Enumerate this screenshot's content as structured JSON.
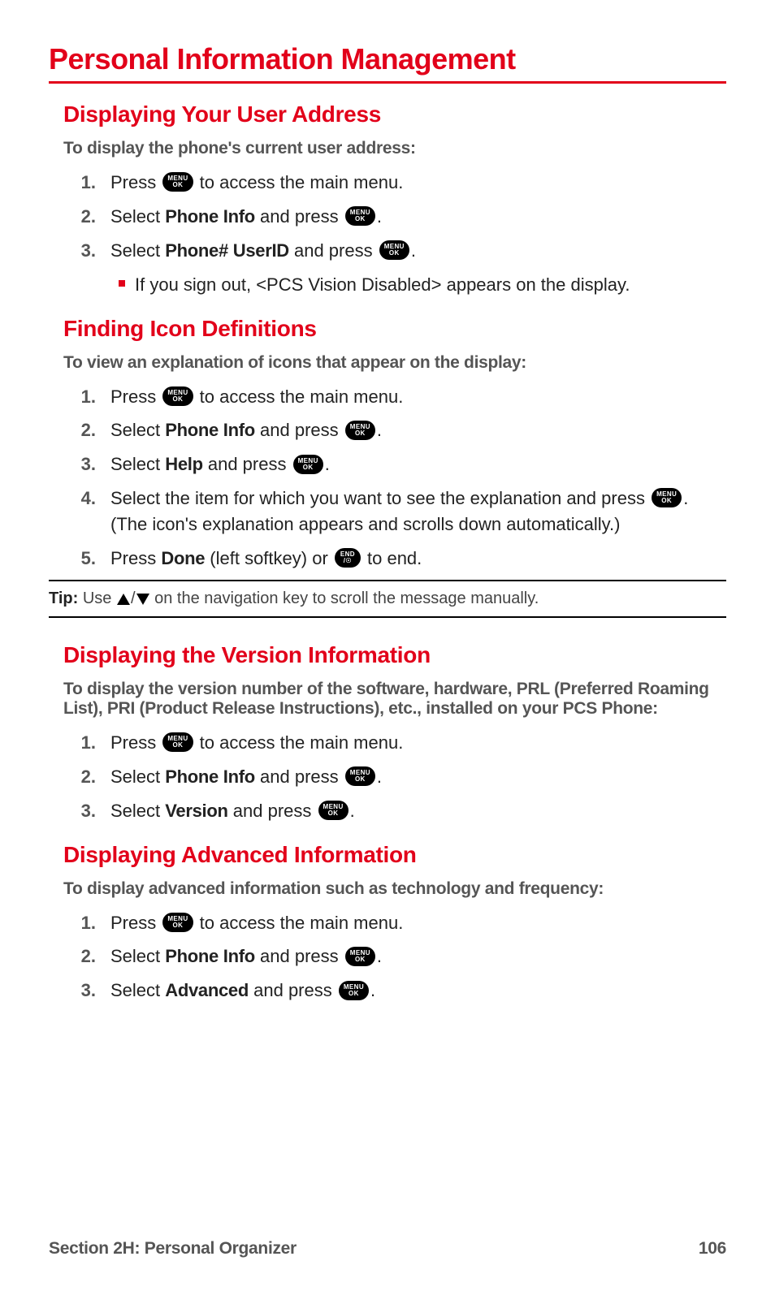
{
  "page_title": "Personal Information Management",
  "sections": [
    {
      "title": "Displaying Your User Address",
      "intro": "To display the phone's current user address:",
      "steps": [
        {
          "num": "1.",
          "pre": "Press ",
          "icon": "menu-ok",
          "post": " to access the main menu."
        },
        {
          "num": "2.",
          "pre": "Select ",
          "bold": "Phone Info",
          "mid": " and press ",
          "icon": "menu-ok",
          "post": "."
        },
        {
          "num": "3.",
          "pre": "Select ",
          "bold": "Phone# UserID",
          "mid": " and press ",
          "icon": "menu-ok",
          "post": "."
        }
      ],
      "sub": "If you sign out, <PCS Vision Disabled> appears on the display."
    },
    {
      "title": "Finding Icon Definitions",
      "intro": "To view an explanation of icons that appear on the display:",
      "steps": [
        {
          "num": "1.",
          "pre": "Press ",
          "icon": "menu-ok",
          "post": " to access the main menu."
        },
        {
          "num": "2.",
          "pre": "Select ",
          "bold": "Phone Info",
          "mid": " and press ",
          "icon": "menu-ok",
          "post": "."
        },
        {
          "num": "3.",
          "pre": "Select ",
          "bold": "Help",
          "mid": " and press ",
          "icon": "menu-ok",
          "post": "."
        },
        {
          "num": "4.",
          "pre": "Select the item for which you want to see the explanation and press ",
          "icon": "menu-ok",
          "post": ". (The icon's explanation appears and scrolls down automatically.)"
        },
        {
          "num": "5.",
          "pre": "Press ",
          "bold": "Done",
          "mid": " (left softkey) or ",
          "icon": "end",
          "post": " to end."
        }
      ]
    },
    {
      "title": "Displaying the Version Information",
      "intro": "To display the version number of the software, hardware, PRL (Preferred Roaming List), PRI (Product Release Instructions), etc., installed on your PCS Phone:",
      "steps": [
        {
          "num": "1.",
          "pre": "Press ",
          "icon": "menu-ok",
          "post": " to access the main menu."
        },
        {
          "num": "2.",
          "pre": "Select ",
          "bold": "Phone Info",
          "mid": " and press ",
          "icon": "menu-ok",
          "post": "."
        },
        {
          "num": "3.",
          "pre": "Select ",
          "bold": "Version",
          "mid": " and press ",
          "icon": "menu-ok",
          "post": "."
        }
      ]
    },
    {
      "title": "Displaying Advanced Information",
      "intro": "To display advanced information such as technology and frequency:",
      "steps": [
        {
          "num": "1.",
          "pre": "Press ",
          "icon": "menu-ok",
          "post": " to access the main menu."
        },
        {
          "num": "2.",
          "pre": "Select ",
          "bold": "Phone Info",
          "mid": " and press ",
          "icon": "menu-ok",
          "post": "."
        },
        {
          "num": "3.",
          "pre": "Select ",
          "bold": "Advanced",
          "mid": " and press ",
          "icon": "menu-ok",
          "post": "."
        }
      ]
    }
  ],
  "tip": {
    "label": "Tip:",
    "pre": " Use ",
    "post": " on the navigation key to scroll the message manually."
  },
  "icons": {
    "menu-ok": {
      "top": "MENU",
      "bottom": "OK"
    },
    "end": {
      "top": "END",
      "bottom": "/☉"
    }
  },
  "footer": {
    "left": "Section 2H: Personal Organizer",
    "right": "106"
  }
}
